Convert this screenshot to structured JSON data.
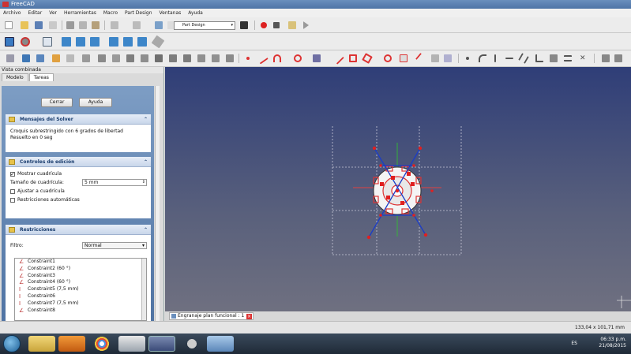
{
  "window": {
    "title": "FreeCAD"
  },
  "menu": [
    "Archivo",
    "Editar",
    "Ver",
    "Herramientas",
    "Macro",
    "Part Design",
    "Ventanas",
    "Ayuda"
  ],
  "workbench_select": {
    "value": "Part Design"
  },
  "combo": {
    "title": "Vista combinada",
    "tabs": [
      "Modelo",
      "Tareas"
    ],
    "active_tab": 1,
    "buttons": {
      "close": "Cerrar",
      "help": "Ayuda"
    },
    "solver": {
      "title": "Mensajes del Solver",
      "lines": [
        "Croquis subrestringido con 6 grados de libertad",
        "Resuelto en 0 seg"
      ]
    },
    "edit": {
      "title": "Controles de edición",
      "show_grid": {
        "label": "Mostrar cuadrícula",
        "checked": true
      },
      "grid_size": {
        "label": "Tamaño de cuadrícula:",
        "value": "5 mm"
      },
      "snap_grid": {
        "label": "Ajustar a cuadrícula",
        "checked": false
      },
      "auto_constraints": {
        "label": "Restricciones automáticas",
        "checked": false
      }
    },
    "constraints": {
      "title": "Restricciones",
      "filter_label": "Filtro:",
      "filter_value": "Normal",
      "items": [
        {
          "label": "Constraint1",
          "icon": "angle-constraint-icon"
        },
        {
          "label": "Constraint2 (60 °)",
          "icon": "angle-constraint-icon"
        },
        {
          "label": "Constraint3",
          "icon": "angle-constraint-icon"
        },
        {
          "label": "Constraint4 (60 °)",
          "icon": "angle-constraint-icon"
        },
        {
          "label": "Constraint5 (7,5 mm)",
          "icon": "distance-constraint-icon"
        },
        {
          "label": "Constraint6",
          "icon": "distance-constraint-icon"
        },
        {
          "label": "Constraint7 (7,5 mm)",
          "icon": "distance-constraint-icon"
        },
        {
          "label": "Constraint8",
          "icon": "angle-constraint-icon"
        }
      ]
    }
  },
  "view": {
    "tab_label": "Engranaje plan funcional : 1",
    "colors": {
      "background_top": "#2f3e78",
      "background_bottom": "#6f7080",
      "sketch": "#d83a3a",
      "construction": "#1a3cc8",
      "axis_x": "#d83a3a",
      "axis_y": "#3aa83a"
    }
  },
  "status": {
    "coords": "133,04 x 101,71 mm"
  },
  "taskbar": {
    "apps": [
      "windows-explorer-icon",
      "media-player-icon",
      "chrome-icon",
      "calculator-icon",
      "freecad-icon",
      "audio-icon",
      "photos-icon"
    ],
    "language": "ES",
    "time": "06:33 p.m.",
    "date": "21/08/2015"
  }
}
